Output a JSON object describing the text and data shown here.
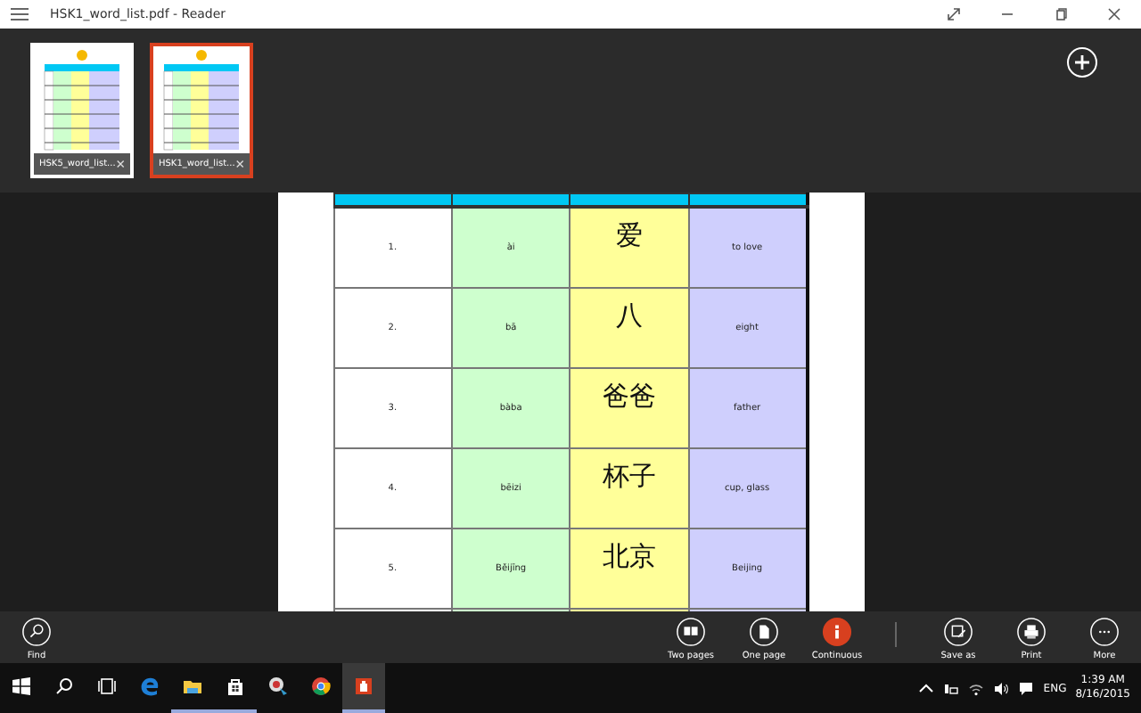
{
  "window": {
    "title": "HSK1_word_list.pdf - Reader"
  },
  "open_files": [
    {
      "label": "HSK5_word_list...",
      "selected": false
    },
    {
      "label": "HSK1_word_list...",
      "selected": true
    }
  ],
  "table": {
    "rows": [
      {
        "number": "1.",
        "pinyin": "ài",
        "hanzi": "爱",
        "english": "to love"
      },
      {
        "number": "2.",
        "pinyin": "bā",
        "hanzi": "八",
        "english": "eight"
      },
      {
        "number": "3.",
        "pinyin": "bàba",
        "hanzi": "爸爸",
        "english": "father"
      },
      {
        "number": "4.",
        "pinyin": "bēizi",
        "hanzi": "杯子",
        "english": "cup, glass"
      },
      {
        "number": "5.",
        "pinyin": "Běijīng",
        "hanzi": "北京",
        "english": "Beijing"
      }
    ]
  },
  "app_bar": {
    "find": {
      "label": "Find"
    },
    "view_modes": [
      {
        "kind": "two",
        "label": "Two pages",
        "selected": false
      },
      {
        "kind": "one",
        "label": "One page",
        "selected": false
      },
      {
        "kind": "continuous",
        "label": "Continuous",
        "selected": true
      }
    ],
    "actions": [
      {
        "kind": "save",
        "label": "Save as"
      },
      {
        "kind": "print",
        "label": "Print"
      },
      {
        "kind": "more",
        "label": "More"
      }
    ]
  },
  "taskbar": {
    "apps": [
      {
        "kind": "edge",
        "running": false,
        "selected": false
      },
      {
        "kind": "folder",
        "running": true,
        "selected": false
      },
      {
        "kind": "store",
        "running": true,
        "selected": false
      },
      {
        "kind": "app",
        "running": false,
        "selected": false
      },
      {
        "kind": "chrome",
        "running": false,
        "selected": false
      },
      {
        "kind": "reader",
        "running": true,
        "selected": true
      }
    ],
    "language": "ENG",
    "time": "1:39 AM",
    "date": "8/16/2015"
  }
}
